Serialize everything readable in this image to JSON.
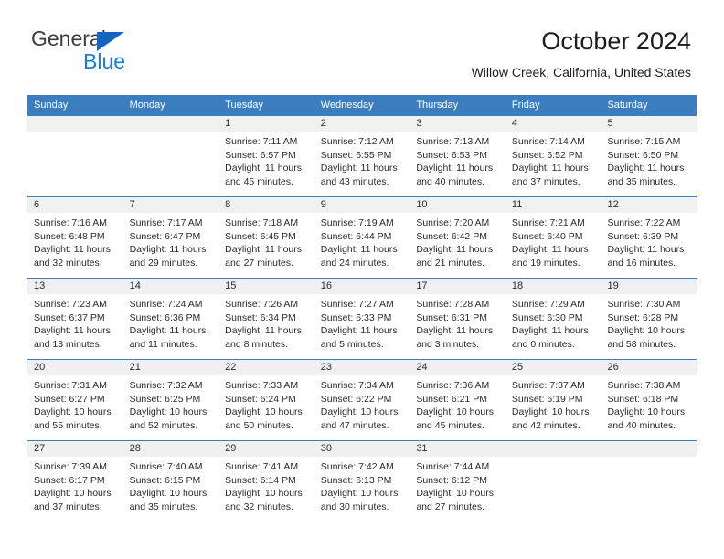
{
  "brand": {
    "name_top": "General",
    "name_bottom": "Blue",
    "accent_color": "#1a7fd4",
    "triangle_color": "#1565c0"
  },
  "header": {
    "title": "October 2024",
    "subtitle": "Willow Creek, California, United States"
  },
  "calendar": {
    "header_bg": "#3a7ebf",
    "daynum_bg": "#f0f0f0",
    "weekdays": [
      "Sunday",
      "Monday",
      "Tuesday",
      "Wednesday",
      "Thursday",
      "Friday",
      "Saturday"
    ],
    "weeks": [
      [
        {
          "day": "",
          "sunrise": "",
          "sunset": "",
          "daylight": ""
        },
        {
          "day": "",
          "sunrise": "",
          "sunset": "",
          "daylight": ""
        },
        {
          "day": "1",
          "sunrise": "Sunrise: 7:11 AM",
          "sunset": "Sunset: 6:57 PM",
          "daylight": "Daylight: 11 hours and 45 minutes."
        },
        {
          "day": "2",
          "sunrise": "Sunrise: 7:12 AM",
          "sunset": "Sunset: 6:55 PM",
          "daylight": "Daylight: 11 hours and 43 minutes."
        },
        {
          "day": "3",
          "sunrise": "Sunrise: 7:13 AM",
          "sunset": "Sunset: 6:53 PM",
          "daylight": "Daylight: 11 hours and 40 minutes."
        },
        {
          "day": "4",
          "sunrise": "Sunrise: 7:14 AM",
          "sunset": "Sunset: 6:52 PM",
          "daylight": "Daylight: 11 hours and 37 minutes."
        },
        {
          "day": "5",
          "sunrise": "Sunrise: 7:15 AM",
          "sunset": "Sunset: 6:50 PM",
          "daylight": "Daylight: 11 hours and 35 minutes."
        }
      ],
      [
        {
          "day": "6",
          "sunrise": "Sunrise: 7:16 AM",
          "sunset": "Sunset: 6:48 PM",
          "daylight": "Daylight: 11 hours and 32 minutes."
        },
        {
          "day": "7",
          "sunrise": "Sunrise: 7:17 AM",
          "sunset": "Sunset: 6:47 PM",
          "daylight": "Daylight: 11 hours and 29 minutes."
        },
        {
          "day": "8",
          "sunrise": "Sunrise: 7:18 AM",
          "sunset": "Sunset: 6:45 PM",
          "daylight": "Daylight: 11 hours and 27 minutes."
        },
        {
          "day": "9",
          "sunrise": "Sunrise: 7:19 AM",
          "sunset": "Sunset: 6:44 PM",
          "daylight": "Daylight: 11 hours and 24 minutes."
        },
        {
          "day": "10",
          "sunrise": "Sunrise: 7:20 AM",
          "sunset": "Sunset: 6:42 PM",
          "daylight": "Daylight: 11 hours and 21 minutes."
        },
        {
          "day": "11",
          "sunrise": "Sunrise: 7:21 AM",
          "sunset": "Sunset: 6:40 PM",
          "daylight": "Daylight: 11 hours and 19 minutes."
        },
        {
          "day": "12",
          "sunrise": "Sunrise: 7:22 AM",
          "sunset": "Sunset: 6:39 PM",
          "daylight": "Daylight: 11 hours and 16 minutes."
        }
      ],
      [
        {
          "day": "13",
          "sunrise": "Sunrise: 7:23 AM",
          "sunset": "Sunset: 6:37 PM",
          "daylight": "Daylight: 11 hours and 13 minutes."
        },
        {
          "day": "14",
          "sunrise": "Sunrise: 7:24 AM",
          "sunset": "Sunset: 6:36 PM",
          "daylight": "Daylight: 11 hours and 11 minutes."
        },
        {
          "day": "15",
          "sunrise": "Sunrise: 7:26 AM",
          "sunset": "Sunset: 6:34 PM",
          "daylight": "Daylight: 11 hours and 8 minutes."
        },
        {
          "day": "16",
          "sunrise": "Sunrise: 7:27 AM",
          "sunset": "Sunset: 6:33 PM",
          "daylight": "Daylight: 11 hours and 5 minutes."
        },
        {
          "day": "17",
          "sunrise": "Sunrise: 7:28 AM",
          "sunset": "Sunset: 6:31 PM",
          "daylight": "Daylight: 11 hours and 3 minutes."
        },
        {
          "day": "18",
          "sunrise": "Sunrise: 7:29 AM",
          "sunset": "Sunset: 6:30 PM",
          "daylight": "Daylight: 11 hours and 0 minutes."
        },
        {
          "day": "19",
          "sunrise": "Sunrise: 7:30 AM",
          "sunset": "Sunset: 6:28 PM",
          "daylight": "Daylight: 10 hours and 58 minutes."
        }
      ],
      [
        {
          "day": "20",
          "sunrise": "Sunrise: 7:31 AM",
          "sunset": "Sunset: 6:27 PM",
          "daylight": "Daylight: 10 hours and 55 minutes."
        },
        {
          "day": "21",
          "sunrise": "Sunrise: 7:32 AM",
          "sunset": "Sunset: 6:25 PM",
          "daylight": "Daylight: 10 hours and 52 minutes."
        },
        {
          "day": "22",
          "sunrise": "Sunrise: 7:33 AM",
          "sunset": "Sunset: 6:24 PM",
          "daylight": "Daylight: 10 hours and 50 minutes."
        },
        {
          "day": "23",
          "sunrise": "Sunrise: 7:34 AM",
          "sunset": "Sunset: 6:22 PM",
          "daylight": "Daylight: 10 hours and 47 minutes."
        },
        {
          "day": "24",
          "sunrise": "Sunrise: 7:36 AM",
          "sunset": "Sunset: 6:21 PM",
          "daylight": "Daylight: 10 hours and 45 minutes."
        },
        {
          "day": "25",
          "sunrise": "Sunrise: 7:37 AM",
          "sunset": "Sunset: 6:19 PM",
          "daylight": "Daylight: 10 hours and 42 minutes."
        },
        {
          "day": "26",
          "sunrise": "Sunrise: 7:38 AM",
          "sunset": "Sunset: 6:18 PM",
          "daylight": "Daylight: 10 hours and 40 minutes."
        }
      ],
      [
        {
          "day": "27",
          "sunrise": "Sunrise: 7:39 AM",
          "sunset": "Sunset: 6:17 PM",
          "daylight": "Daylight: 10 hours and 37 minutes."
        },
        {
          "day": "28",
          "sunrise": "Sunrise: 7:40 AM",
          "sunset": "Sunset: 6:15 PM",
          "daylight": "Daylight: 10 hours and 35 minutes."
        },
        {
          "day": "29",
          "sunrise": "Sunrise: 7:41 AM",
          "sunset": "Sunset: 6:14 PM",
          "daylight": "Daylight: 10 hours and 32 minutes."
        },
        {
          "day": "30",
          "sunrise": "Sunrise: 7:42 AM",
          "sunset": "Sunset: 6:13 PM",
          "daylight": "Daylight: 10 hours and 30 minutes."
        },
        {
          "day": "31",
          "sunrise": "Sunrise: 7:44 AM",
          "sunset": "Sunset: 6:12 PM",
          "daylight": "Daylight: 10 hours and 27 minutes."
        },
        {
          "day": "",
          "sunrise": "",
          "sunset": "",
          "daylight": ""
        },
        {
          "day": "",
          "sunrise": "",
          "sunset": "",
          "daylight": ""
        }
      ]
    ]
  }
}
